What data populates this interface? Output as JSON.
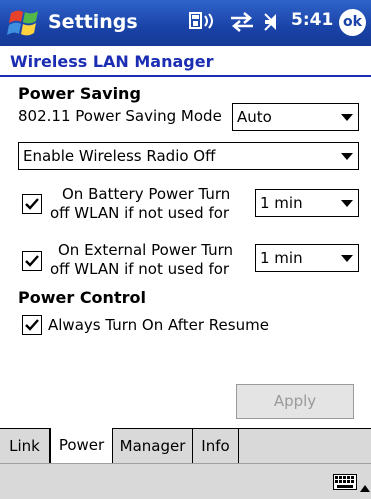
{
  "titlebar": {
    "title": "Settings",
    "time": "5:41",
    "ok_label": "ok"
  },
  "page_title": "Wireless LAN Manager",
  "power_saving": {
    "heading": "Power Saving",
    "mode_label": "802.11 Power Saving Mode",
    "mode_value": "Auto",
    "radio_value": "Enable Wireless Radio Off",
    "battery": {
      "checked": true,
      "line1": "On Battery Power Turn",
      "line2": "off WLAN if not used for",
      "value": "1 min"
    },
    "external": {
      "checked": true,
      "line1": "On External Power Turn",
      "line2": "off WLAN if not used for",
      "value": "1 min"
    }
  },
  "power_control": {
    "heading": "Power Control",
    "always_on_label": "Always Turn On After Resume",
    "always_on_checked": true
  },
  "apply_label": "Apply",
  "tabs": [
    {
      "label": "Link",
      "active": false
    },
    {
      "label": "Power",
      "active": true
    },
    {
      "label": "Manager",
      "active": false
    },
    {
      "label": "Info",
      "active": false
    }
  ],
  "icons": {
    "start": "windows-flag-icon",
    "connectivity": "connectivity-icon",
    "sync": "sync-arrows-icon",
    "volume": "speaker-icon",
    "keyboard": "keyboard-icon",
    "sip_arrow": "chevron-up-icon"
  },
  "colors": {
    "titlebar": "#1a43a8",
    "page_title": "#1b2eb3"
  }
}
